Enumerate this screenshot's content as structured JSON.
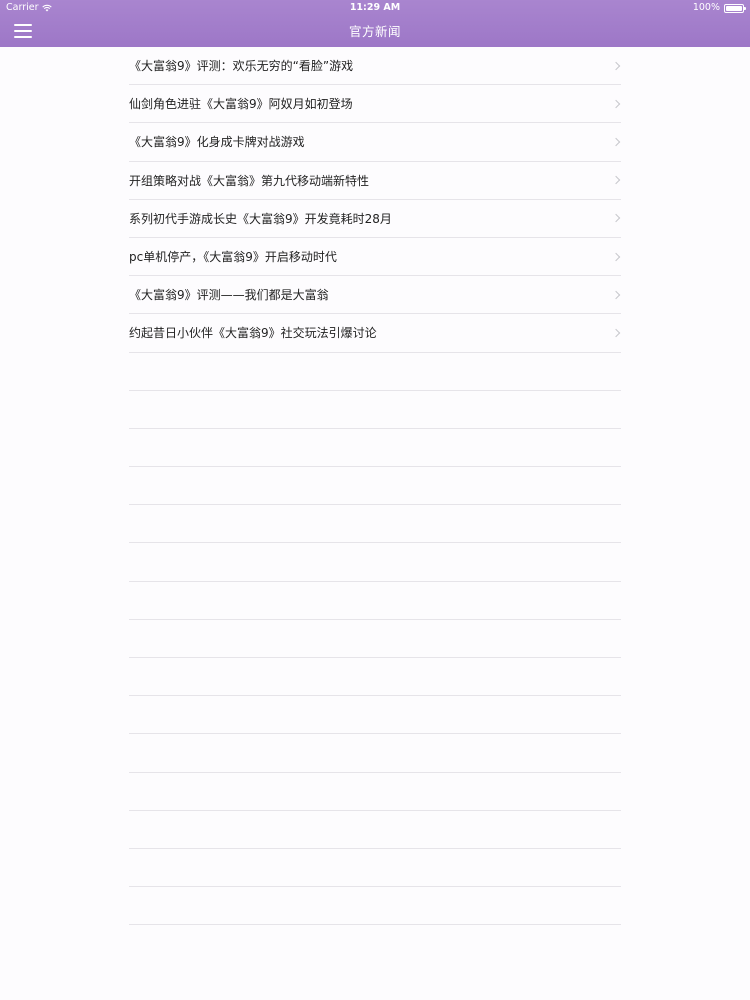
{
  "status_bar": {
    "carrier": "Carrier",
    "time": "11:29 AM",
    "battery": "100%"
  },
  "navbar": {
    "title": "官方新闻",
    "menu_icon": "hamburger-icon"
  },
  "news": [
    {
      "title": "《大富翁9》评测：欢乐无穷的“看脸”游戏"
    },
    {
      "title": "仙剑角色进驻《大富翁9》阿奴月如初登场"
    },
    {
      "title": "《大富翁9》化身成卡牌对战游戏"
    },
    {
      "title": "开组策略对战《大富翁》第九代移动端新特性"
    },
    {
      "title": "系列初代手游成长史《大富翁9》开发竟耗时28月"
    },
    {
      "title": "pc单机停产，《大富翁9》开启移动时代"
    },
    {
      "title": "《大富翁9》评测——我们都是大富翁"
    },
    {
      "title": "约起昔日小伙伴《大富翁9》社交玩法引爆讨论"
    }
  ],
  "colors": {
    "header": "#9d77c7",
    "background": "#fdfcfe",
    "separator": "#e6e4e9"
  }
}
